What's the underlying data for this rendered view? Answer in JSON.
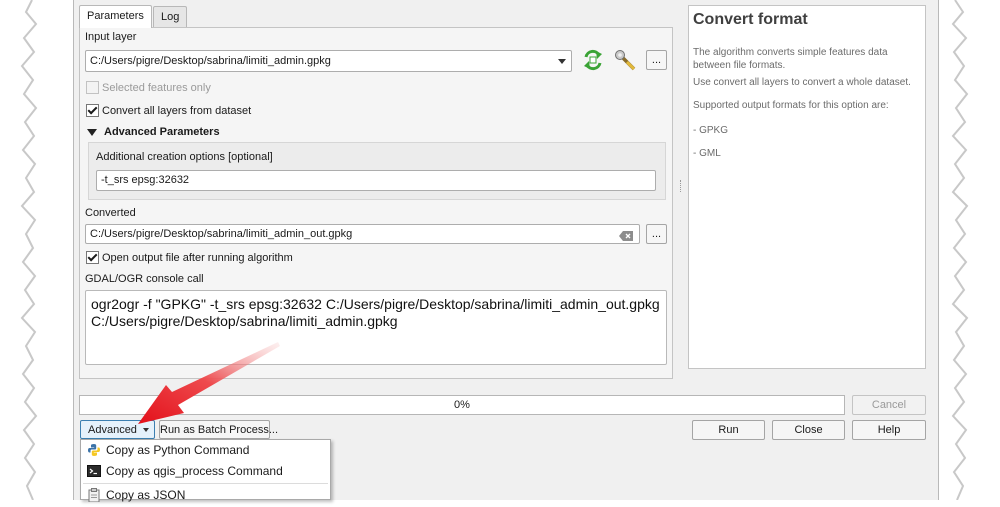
{
  "tabs": [
    {
      "label": "Parameters",
      "active": true
    },
    {
      "label": "Log",
      "active": false
    }
  ],
  "params": {
    "input_layer_label": "Input layer",
    "input_layer_value": "C:/Users/pigre/Desktop/sabrina/limiti_admin.gpkg",
    "selected_only_label": "Selected features only",
    "convert_all_label": "Convert all layers from dataset",
    "advanced_header": "Advanced Parameters",
    "creation_options_label": "Additional creation options [optional]",
    "creation_options_value": "-t_srs epsg:32632",
    "converted_label": "Converted",
    "converted_value": "C:/Users/pigre/Desktop/sabrina/limiti_admin_out.gpkg",
    "open_output_label": "Open output file after running algorithm",
    "console_label": "GDAL/OGR console call",
    "console_line1": "ogr2ogr -f \"GPKG\" -t_srs epsg:32632 C:/Users/pigre/Desktop/sabrina/limiti_admin_out.gpkg",
    "console_line2": "C:/Users/pigre/Desktop/sabrina/limiti_admin.gpkg",
    "browse_label": "..."
  },
  "help": {
    "title": "Convert format",
    "p1": "The algorithm converts simple features data between file formats.",
    "p2": "Use convert all layers to convert a whole dataset.",
    "p3": "Supported output formats for this option are:",
    "p4": "- GPKG",
    "p5": "- GML"
  },
  "progress": {
    "value": 0,
    "label": "0%"
  },
  "buttons": {
    "cancel": "Cancel",
    "advanced": "Advanced",
    "batch": "Run as Batch Process...",
    "run": "Run",
    "close": "Close",
    "help": "Help"
  },
  "menu": {
    "items": [
      {
        "label": "Copy as Python Command",
        "icon": "python-icon"
      },
      {
        "label": "Copy as qgis_process Command",
        "icon": "terminal-icon"
      },
      {
        "label": "Copy as JSON",
        "icon": "clipboard-icon"
      }
    ]
  },
  "colors": {
    "arrow": "#e8161b",
    "refresh_icon": "#3aa335"
  }
}
